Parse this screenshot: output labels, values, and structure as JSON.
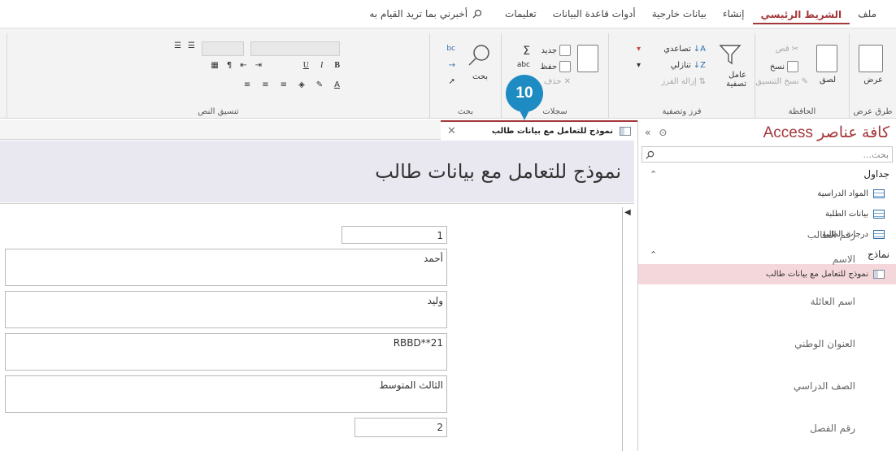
{
  "ribbon_tabs": [
    "ملف",
    "الشريط الرئيسي",
    "إنشاء",
    "بيانات خارجية",
    "أدوات قاعدة البيانات",
    "تعليمات"
  ],
  "tell_me": "أخبرني بما تريد القيام به",
  "groups": {
    "views": {
      "label": "طرق عرض",
      "view": "عرض"
    },
    "clipboard": {
      "label": "الحافظة",
      "paste": "لصق",
      "cut": "قص",
      "copy": "نسخ",
      "format_painter": "نسخ التنسيق"
    },
    "sort_filter": {
      "label": "فرز وتصفية",
      "filter": "عامل تصفية",
      "ascending": "تصاعدي",
      "descending": "تنازلي",
      "remove_sort": "إزالة الفرز"
    },
    "records": {
      "label": "سجلات",
      "new": "جديد",
      "save": "حفظ",
      "delete": "حذف"
    },
    "find": {
      "label": "بحث",
      "find": "بحث"
    },
    "text_formatting": {
      "label": "تنسيق النص"
    }
  },
  "callout": "10",
  "nav": {
    "title": "كافة عناصر Access",
    "search_placeholder": "بحث...",
    "tables_header": "جداول",
    "tables": [
      "المواد الدراسية",
      "بيانات الطلبة",
      "درجات الطلبة"
    ],
    "forms_header": "نماذج",
    "forms": [
      "نموذج للتعامل مع بيانات طالب"
    ]
  },
  "doc_tab": "نموذج للتعامل مع بيانات طالب",
  "form": {
    "title": "نموذج للتعامل مع بيانات طالب",
    "fields": [
      {
        "label": "رقم الطالب",
        "value": "1"
      },
      {
        "label": "الاسم",
        "value": "أحمد"
      },
      {
        "label": "اسم العائلة",
        "value": "وليد"
      },
      {
        "label": "العنوان الوطني",
        "value": "RBBD**21"
      },
      {
        "label": "الصف الدراسي",
        "value": "الثالث المتوسط"
      },
      {
        "label": "رقم الفصل",
        "value": "2"
      }
    ]
  }
}
